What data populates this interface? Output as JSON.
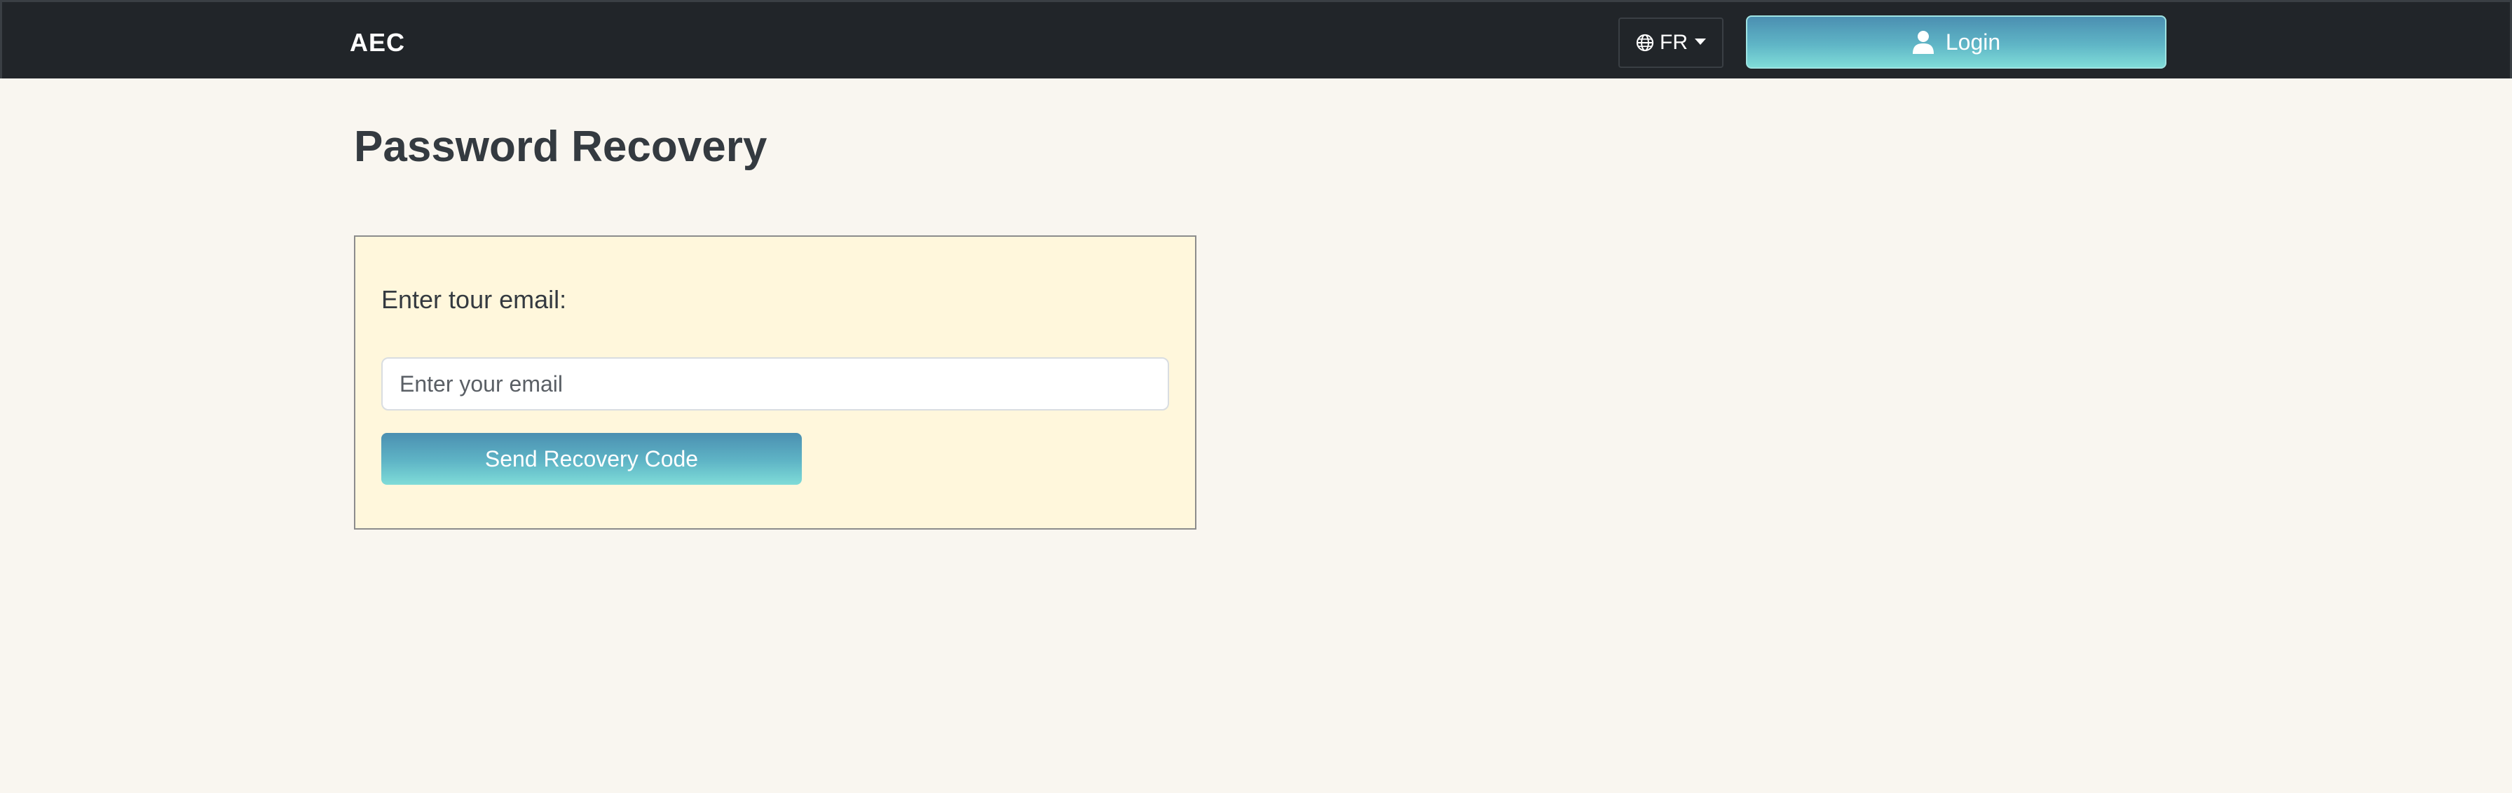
{
  "navbar": {
    "brand": "AEC",
    "language": {
      "label": "FR",
      "icon": "globe-icon"
    },
    "login": {
      "label": "Login",
      "icon": "user-icon"
    }
  },
  "main": {
    "title": "Password Recovery",
    "form": {
      "label": "Enter tour email:",
      "email_placeholder": "Enter your email",
      "email_value": "",
      "submit_label": "Send Recovery Code"
    }
  },
  "colors": {
    "navbar_bg": "#212529",
    "page_bg": "#f9f6f0",
    "card_bg": "#fff7dc",
    "button_gradient_top": "#4b8fb1",
    "button_gradient_bottom": "#7fdcd8"
  }
}
